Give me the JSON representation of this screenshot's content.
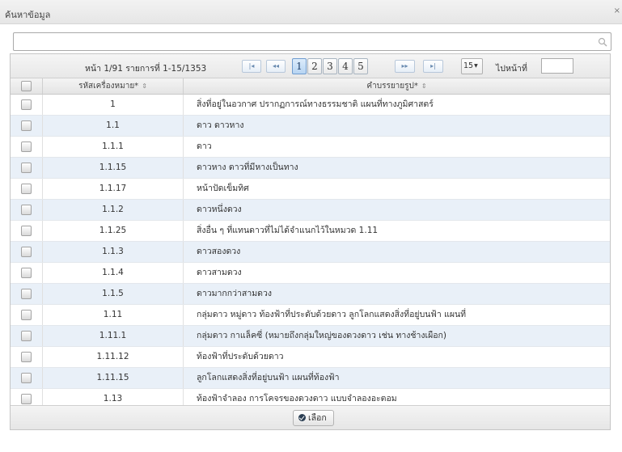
{
  "dialog": {
    "title": "ค้นหาข้อมูล",
    "close_icon": "close-icon"
  },
  "search": {
    "value": "",
    "placeholder": ""
  },
  "pager": {
    "info": "หน้า 1/91 รายการที่ 1-15/1353",
    "first": "|◂",
    "prev": "◂◂",
    "next": "▸▸",
    "last": "▸|",
    "pages": [
      "1",
      "2",
      "3",
      "4",
      "5"
    ],
    "active_page": "1",
    "page_size": "15",
    "goto_label": "ไปหน้าที่",
    "goto_value": ""
  },
  "table": {
    "headers": {
      "code": "รหัสเครื่องหมาย*",
      "desc": "คำบรรยายรูป*",
      "sort_icon": "sort-icon"
    },
    "rows": [
      {
        "code": "1",
        "desc": "สิ่งที่อยู่ในอวกาศ ปรากฏการณ์ทางธรรมชาติ แผนที่ทางภูมิศาสตร์"
      },
      {
        "code": "1.1",
        "desc": "ดาว ดาวหาง"
      },
      {
        "code": "1.1.1",
        "desc": "ดาว"
      },
      {
        "code": "1.1.15",
        "desc": "ดาวหาง ดาวที่มีหางเป็นทาง"
      },
      {
        "code": "1.1.17",
        "desc": "หน้าปัดเข็มทิศ"
      },
      {
        "code": "1.1.2",
        "desc": "ดาวหนึ่งดวง"
      },
      {
        "code": "1.1.25",
        "desc": "สิ่งอื่น ๆ ที่แทนดาวที่ไม่ได้จำแนกไว้ในหมวด 1.11"
      },
      {
        "code": "1.1.3",
        "desc": "ดาวสองดวง"
      },
      {
        "code": "1.1.4",
        "desc": "ดาวสามดวง"
      },
      {
        "code": "1.1.5",
        "desc": "ดาวมากกว่าสามดวง"
      },
      {
        "code": "1.11",
        "desc": "กลุ่มดาว หมู่ดาว ท้องฟ้าที่ประดับด้วยดาว ลูกโลกแสดงสิ่งที่อยู่บนฟ้า แผนที่"
      },
      {
        "code": "1.11.1",
        "desc": "กลุ่มดาว กาแล็คซี่ (หมายถึงกลุ่มใหญ่ของดวงดาว เช่น ทางช้างเผือก)"
      },
      {
        "code": "1.11.12",
        "desc": "ท้องฟ้าที่ประดับด้วยดาว"
      },
      {
        "code": "1.11.15",
        "desc": "ลูกโลกแสดงสิ่งที่อยู่บนฟ้า แผนที่ท้องฟ้า"
      },
      {
        "code": "1.13",
        "desc": "ท้องฟ้าจำลอง การโคจรของดวงดาว แบบจำลองอะตอม"
      }
    ]
  },
  "footer": {
    "select_label": "เลือก",
    "select_icon": "check-circle-icon"
  },
  "colors": {
    "row_alt": "#e9f0f8",
    "active_page": "#b7d4f2",
    "border": "#c5c5c5"
  }
}
